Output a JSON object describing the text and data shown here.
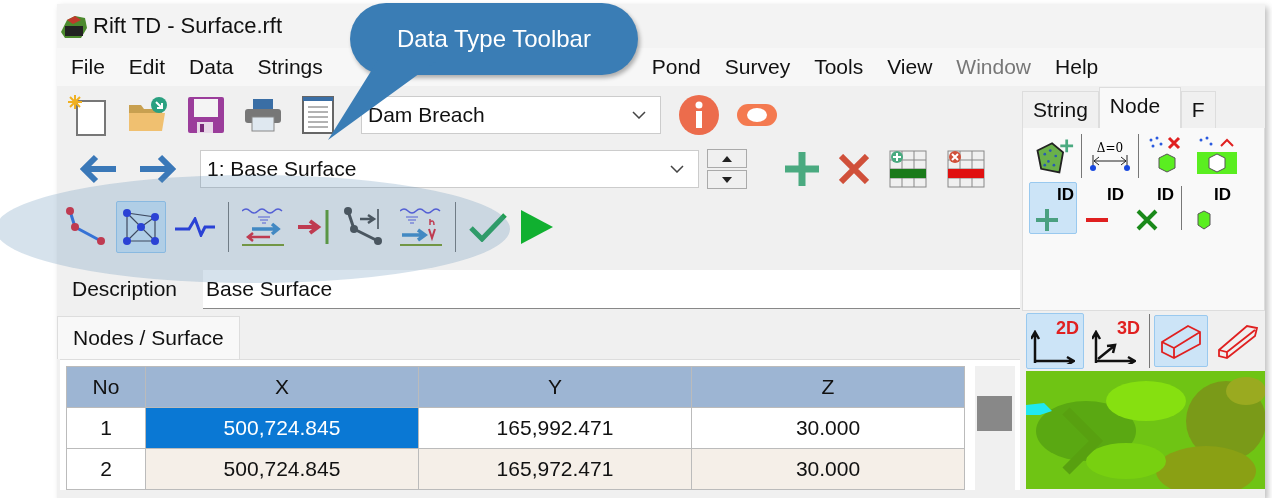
{
  "window": {
    "title": "Rift TD - Surface.rft"
  },
  "menu": [
    {
      "label": "File",
      "disabled": false
    },
    {
      "label": "Edit",
      "disabled": false
    },
    {
      "label": "Data",
      "disabled": false
    },
    {
      "label": "Strings",
      "disabled": false
    },
    {
      "kind": "hidden"
    },
    {
      "label": "Pond",
      "disabled": false
    },
    {
      "label": "Survey",
      "disabled": false
    },
    {
      "label": "Tools",
      "disabled": false
    },
    {
      "label": "View",
      "disabled": false
    },
    {
      "label": "Window",
      "disabled": true
    },
    {
      "label": "Help",
      "disabled": false
    }
  ],
  "callout": {
    "text": "Data Type Toolbar"
  },
  "toolbar": {
    "data_set": "Dam Breach",
    "surface": "1: Base Surface"
  },
  "data_type_tools": [
    {
      "kind": "string",
      "selected": false
    },
    {
      "kind": "mesh",
      "selected": true
    },
    {
      "kind": "profile",
      "selected": false
    },
    {
      "kind": "separator"
    },
    {
      "kind": "flow",
      "selected": false
    },
    {
      "kind": "to-line",
      "selected": false
    },
    {
      "kind": "breakline",
      "selected": false
    },
    {
      "kind": "velocity",
      "selected": false
    },
    {
      "kind": "separator"
    },
    {
      "kind": "check",
      "selected": false
    },
    {
      "kind": "run",
      "selected": false
    }
  ],
  "description": {
    "label": "Description",
    "value": "Base Surface"
  },
  "bottom_tabs": [
    {
      "label": "Nodes / Surface",
      "selected": true
    }
  ],
  "table": {
    "columns": [
      "No",
      "X",
      "Y",
      "Z"
    ],
    "rows": [
      {
        "cells": [
          {
            "text": "1",
            "selected": false
          },
          {
            "text": "500,724.845",
            "selected": true
          },
          {
            "text": "165,992.471",
            "selected": false
          },
          {
            "text": "30.000",
            "selected": false
          }
        ]
      },
      {
        "cells": [
          {
            "text": "2",
            "selected": false
          },
          {
            "text": "500,724.845",
            "selected": false
          },
          {
            "text": "165,972.471",
            "selected": false
          },
          {
            "text": "30.000",
            "selected": false
          }
        ]
      }
    ]
  },
  "side_panel": {
    "tabs": [
      {
        "label": "String",
        "selected": false
      },
      {
        "label": "Node",
        "selected": true
      },
      {
        "label": "F",
        "selected": false
      }
    ],
    "node_tools": [
      {
        "kind": "polygon-add",
        "selected": false
      },
      {
        "kind": "separator"
      },
      {
        "kind": "delta",
        "label": "Δ=0",
        "selected": false
      },
      {
        "kind": "separator"
      },
      {
        "kind": "delete-points",
        "selected": false
      },
      {
        "kind": "polygon-cut",
        "selected": false
      },
      {
        "kind": "break"
      },
      {
        "kind": "id-add",
        "label": "ID",
        "selected": true
      },
      {
        "kind": "id-remove",
        "label": "ID",
        "selected": false
      },
      {
        "kind": "id-delete",
        "label": "ID",
        "selected": false
      },
      {
        "kind": "separator"
      },
      {
        "kind": "id-select",
        "label": "ID",
        "selected": false
      }
    ],
    "view_tools": [
      {
        "kind": "axes-2d",
        "label": "2D",
        "selected": true
      },
      {
        "kind": "axes-3d",
        "label": "3D",
        "selected": false
      },
      {
        "kind": "separator"
      },
      {
        "kind": "box",
        "selected": true
      },
      {
        "kind": "wedge",
        "selected": false
      }
    ]
  }
}
